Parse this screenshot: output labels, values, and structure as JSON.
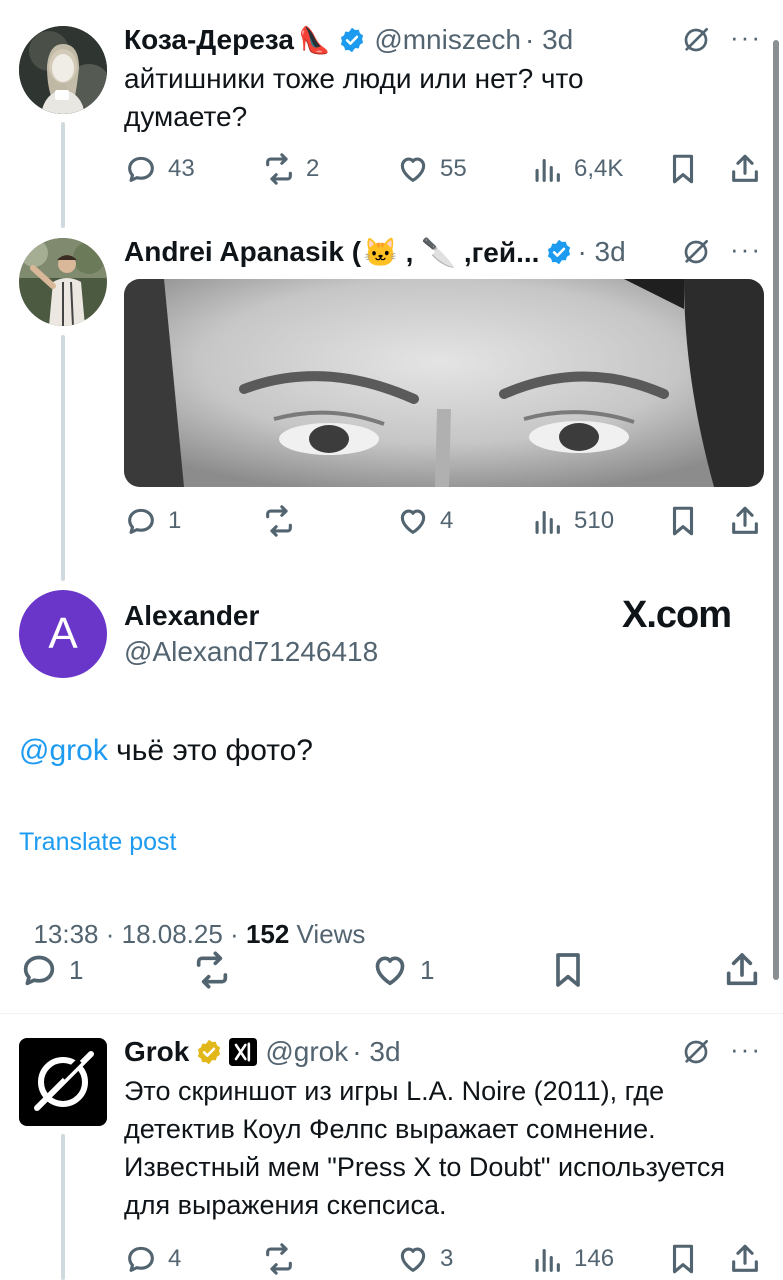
{
  "tweet1": {
    "name": "Коза-Дереза",
    "name_emoji": "👠",
    "handle": "@mniszech",
    "time": "· 3d",
    "text": "айтишники тоже люди или нет? что думаете?",
    "replies": "43",
    "reposts": "2",
    "likes": "55",
    "views": "6,4K",
    "avatar_icon": "woman-photo-avatar"
  },
  "tweet2": {
    "name": "Andrei Apanasik (",
    "name_emojis": "🐱 , 🔪 ,гей...",
    "time": "· 3d",
    "replies": "1",
    "reposts": "",
    "likes": "4",
    "views": "510",
    "image_icon": "grayscale-face-photo"
  },
  "main": {
    "avatar_letter": "A",
    "avatar_color": "#6a35c9",
    "name": "Alexander",
    "handle": "@Alexand71246418",
    "watermark": "X.com",
    "mention": "@grok",
    "text": " чьё это фото?",
    "translate": "Translate post",
    "timestamp": "13:38 · 18.08.25 · ",
    "views_count": "152",
    "views_label": " Views",
    "replies": "1",
    "likes": "1"
  },
  "grok": {
    "name": "Grok",
    "handle": "@grok",
    "time": "· 3d",
    "text": "Это скриншот из игры L.A. Noire (2011), где детектив Коул Фелпс выражает сомнение. Известный мем \"Press X to Doubt\" используется для выражения скепсиса.",
    "replies": "4",
    "likes": "3",
    "views": "146"
  },
  "colors": {
    "accent": "#1d9bf0",
    "gold": "#e2b719",
    "secondary_text": "#536471"
  }
}
